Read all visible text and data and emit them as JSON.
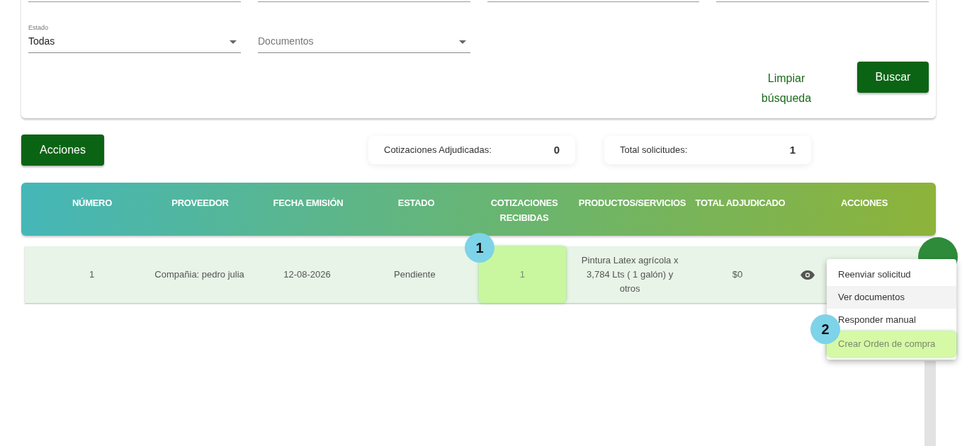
{
  "filters": [
    {
      "label": "Estado",
      "value": "Todas"
    },
    {
      "placeholder": "Documentos"
    }
  ],
  "clear_button": "Limpiar búsqueda",
  "search_button": "Buscar",
  "actions_button": "Acciones",
  "stats": [
    {
      "label": "Cotizaciones Adjudicadas:",
      "value": "0"
    },
    {
      "label": "Total solicitudes:",
      "value": "1"
    }
  ],
  "table": {
    "columns": [
      "NÚMERO",
      "PROVEEDOR",
      "FECHA EMISIÓN",
      "ESTADO",
      "COTIZACIONES RECIBIDAS",
      "PRODUCTOS/SERVICIOS",
      "TOTAL ADJUDICADO",
      "ACCIONES"
    ],
    "rows": [
      {
        "cells": [
          {
            "text": "1",
            "highlighted": false
          },
          {
            "text": "Compañia: pedro julia",
            "highlighted": false
          },
          {
            "text": "12-08-2026",
            "highlighted": false
          },
          {
            "text": "Pendiente",
            "highlighted": false
          },
          {
            "text": "1",
            "highlighted": true
          },
          {
            "text": "Pintura Latex agrícola x 3,784 Lts ( 1 galón) y otros",
            "highlighted": false
          },
          {
            "text": "$0",
            "highlighted": false
          }
        ]
      }
    ]
  },
  "menu": {
    "items": [
      {
        "label": "Reenviar solicitud",
        "hovered": false,
        "highlighted": false
      },
      {
        "label": "Ver documentos",
        "hovered": true,
        "highlighted": false
      },
      {
        "label": "Responder manual",
        "hovered": false,
        "highlighted": false
      },
      {
        "label": "Crear Orden de compra",
        "hovered": false,
        "highlighted": true
      }
    ]
  },
  "tour_markers": [
    {
      "label": "1"
    },
    {
      "label": "2"
    }
  ]
}
